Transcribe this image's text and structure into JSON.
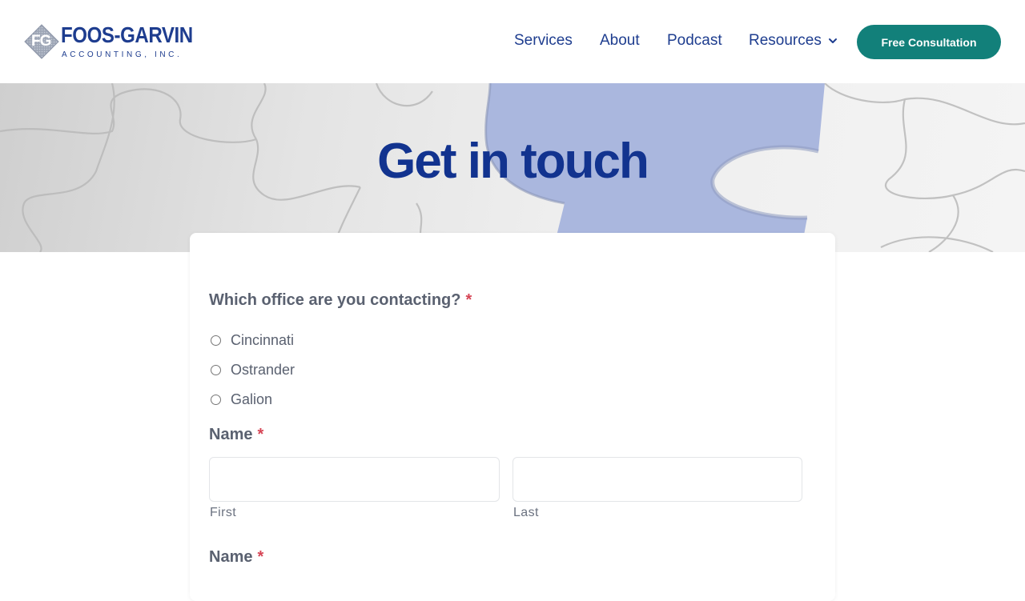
{
  "brand": {
    "logo_mark": "FG",
    "name": "FOOS-GARVIN",
    "tagline": "ACCOUNTING, INC.",
    "primary_color": "#1e3d8f",
    "accent_color": "#12807a"
  },
  "nav": {
    "items": [
      {
        "label": "Services"
      },
      {
        "label": "About"
      },
      {
        "label": "Podcast"
      },
      {
        "label": "Resources",
        "icon": "chevron-down-icon"
      }
    ],
    "cta_label": "Free Consultation"
  },
  "hero": {
    "title": "Get in touch"
  },
  "form": {
    "office_question": {
      "label": "Which office are you contacting?",
      "required_mark": "*",
      "options": [
        {
          "label": "Cincinnati",
          "selected": false
        },
        {
          "label": "Ostrander",
          "selected": false
        },
        {
          "label": "Galion",
          "selected": false
        }
      ]
    },
    "name_field": {
      "label": "Name",
      "required_mark": "*",
      "first": {
        "value": "",
        "sublabel": "First"
      },
      "last": {
        "value": "",
        "sublabel": "Last"
      }
    },
    "name_field_2": {
      "label": "Name",
      "required_mark": "*"
    }
  }
}
